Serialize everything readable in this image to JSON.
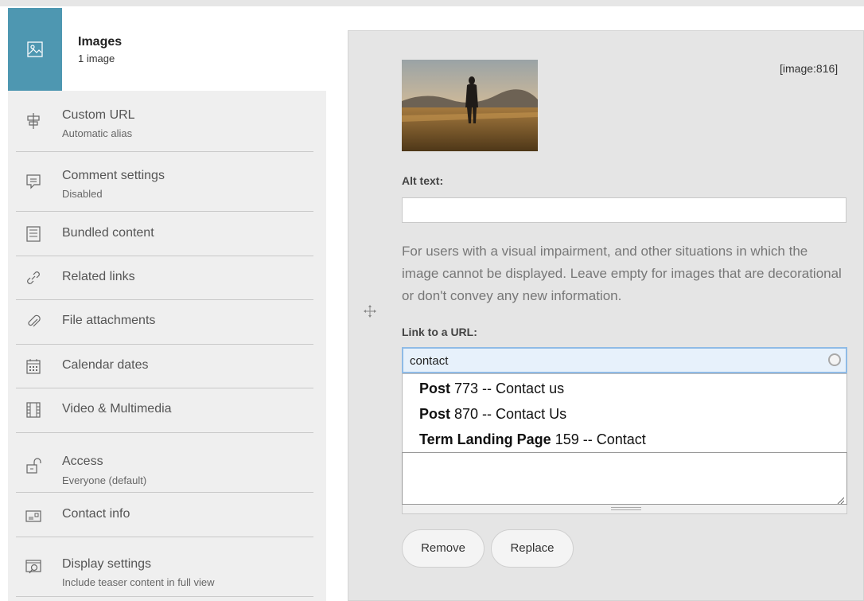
{
  "sidebar": {
    "active": {
      "title": "Images",
      "subtitle": "1 image",
      "icon": "image-icon"
    },
    "items": [
      {
        "label": "Custom URL",
        "description": "Automatic alias",
        "icon": "signpost-icon"
      },
      {
        "label": "Comment settings",
        "description": "Disabled",
        "icon": "comment-icon"
      },
      {
        "label": "Bundled content",
        "description": "",
        "icon": "bundle-icon"
      },
      {
        "label": "Related links",
        "description": "",
        "icon": "link-icon"
      },
      {
        "label": "File attachments",
        "description": "",
        "icon": "paperclip-icon"
      },
      {
        "label": "Calendar dates",
        "description": "",
        "icon": "calendar-icon"
      },
      {
        "label": "Video & Multimedia",
        "description": "",
        "icon": "film-icon"
      },
      {
        "label": "Access",
        "description": "Everyone (default)",
        "icon": "unlock-icon"
      },
      {
        "label": "Contact info",
        "description": "",
        "icon": "contact-card-icon"
      },
      {
        "label": "Display settings",
        "description": "Include teaser content in full view",
        "icon": "display-settings-icon"
      }
    ]
  },
  "image": {
    "id_label": "[image:816]",
    "alt_label": "Alt text:",
    "alt_value": "",
    "alt_help": "For users with a visual impairment, and other situations in which the image cannot be displayed. Leave empty for images that are decorational or don't convey any new information.",
    "link_label": "Link to a URL:",
    "link_value": "contact"
  },
  "autocomplete": [
    {
      "type": "Post",
      "rest": " 773 -- Contact us"
    },
    {
      "type": "Post",
      "rest": " 870 -- Contact Us"
    },
    {
      "type": "Term Landing Page",
      "rest": " 159 -- Contact"
    }
  ],
  "buttons": {
    "remove": "Remove",
    "replace": "Replace"
  },
  "colors": {
    "accent": "#4e97b1",
    "panel": "#e5e5e5",
    "sidebar": "#efefef",
    "focus_border": "#8fbbe6"
  }
}
